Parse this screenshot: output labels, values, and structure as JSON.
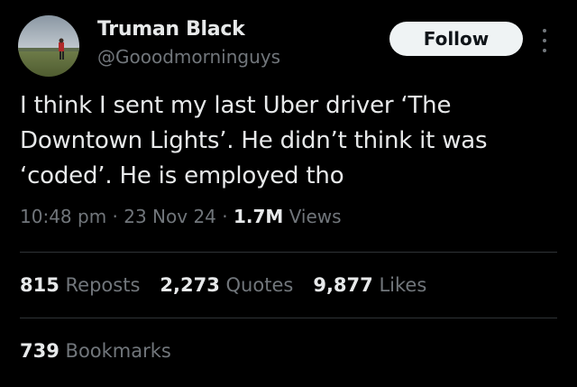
{
  "author": {
    "display_name": "Truman Black",
    "handle": "@Gooodmorninguys"
  },
  "follow_button": {
    "label": "Follow"
  },
  "tweet": {
    "text": "I think I sent my last Uber driver ‘The\nDowntown Lights’. He didn’t think it was\n‘coded’. He is employed tho"
  },
  "meta": {
    "time": "10:48 pm",
    "separator": "·",
    "date": "23 Nov 24",
    "views_count": "1.7M",
    "views_label": "Views"
  },
  "stats": {
    "reposts_count": "815",
    "reposts_label": "Reposts",
    "quotes_count": "2,273",
    "quotes_label": "Quotes",
    "likes_count": "9,877",
    "likes_label": "Likes",
    "bookmarks_count": "739",
    "bookmarks_label": "Bookmarks"
  },
  "colors": {
    "background": "#000000",
    "text_primary": "#e7e9ea",
    "text_secondary": "#71767b",
    "divider": "#2f3336",
    "button_bg": "#eff3f4"
  },
  "icons": {
    "more": "more-horizontal-dots-icon"
  }
}
